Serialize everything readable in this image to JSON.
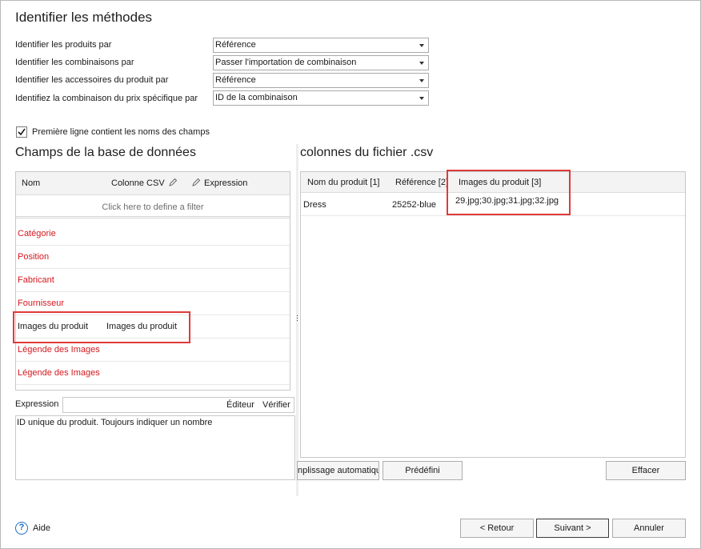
{
  "header": {
    "title": "Identifier les méthodes"
  },
  "identify": [
    {
      "label": "Identifier les produits par",
      "value": "Référence"
    },
    {
      "label": "Identifier les combinaisons par",
      "value": "Passer l'importation de combinaison"
    },
    {
      "label": "Identifier les accessoires du produit par",
      "value": "Référence"
    },
    {
      "label": "Identifiez la combinaison du prix spécifique par",
      "value": "ID de la combinaison"
    }
  ],
  "first_row_checkbox": {
    "label": "Première ligne contient les noms des champs",
    "checked": true
  },
  "db_fields": {
    "title": "Champs de la base de données",
    "columns": {
      "name": "Nom",
      "csv": "Colonne CSV",
      "expression": "Expression"
    },
    "filter_text": "Click here to define a filter",
    "rows": [
      {
        "name": "Catégorie",
        "csv": ""
      },
      {
        "name": "Position",
        "csv": ""
      },
      {
        "name": "Fabricant",
        "csv": ""
      },
      {
        "name": "Fournisseur",
        "csv": ""
      },
      {
        "name": "Images du produit",
        "csv": "Images du produit"
      },
      {
        "name": "Légende des Images",
        "csv": ""
      },
      {
        "name": "Légende des Images",
        "csv": ""
      }
    ]
  },
  "expression": {
    "label": "Expression",
    "editor_label": "Éditeur",
    "verify_label": "Vérifier",
    "description": "ID unique du produit. Toujours indiquer un nombre"
  },
  "csv_columns": {
    "title": "colonnes du fichier .csv",
    "headers": [
      "Nom du produit [1]",
      "Référence [2]",
      "Images du produit [3]"
    ],
    "rows": [
      [
        "Dress",
        "25252-blue",
        "29.jpg;30.jpg;31.jpg;32.jpg"
      ]
    ]
  },
  "mapping_buttons": {
    "autofill": "nplissage automatique",
    "predefined": "Prédéfini",
    "clear": "Effacer"
  },
  "footer": {
    "help": "Aide",
    "back": "< Retour",
    "next": "Suivant >",
    "cancel": "Annuler"
  },
  "colors": {
    "required_field": "#d6181f",
    "highlight": "#e03a3a",
    "help_icon": "#1f6fc5"
  }
}
